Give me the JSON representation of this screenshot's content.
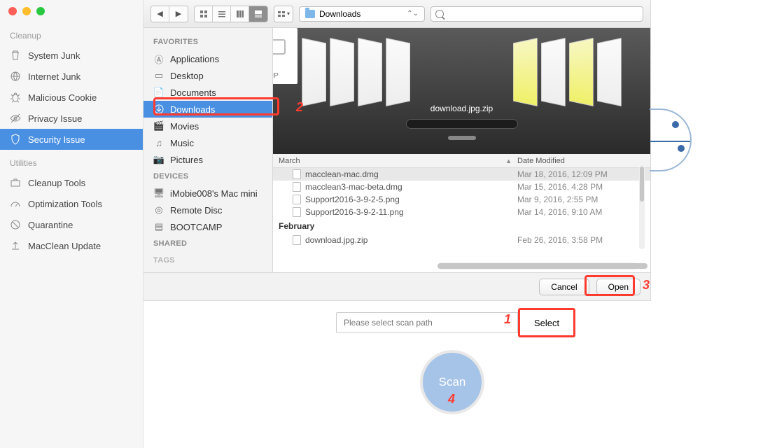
{
  "app": {
    "sections": {
      "cleanup": "Cleanup",
      "utilities": "Utilities"
    },
    "cleanup_items": [
      {
        "label": "System Junk",
        "icon": "trash"
      },
      {
        "label": "Internet Junk",
        "icon": "globe"
      },
      {
        "label": "Malicious Cookie",
        "icon": "bug"
      },
      {
        "label": "Privacy Issue",
        "icon": "eye"
      },
      {
        "label": "Security Issue",
        "icon": "shield",
        "active": true
      }
    ],
    "util_items": [
      {
        "label": "Cleanup Tools",
        "icon": "briefcase"
      },
      {
        "label": "Optimization Tools",
        "icon": "gauge"
      },
      {
        "label": "Quarantine",
        "icon": "block"
      },
      {
        "label": "MacClean Update",
        "icon": "upload"
      }
    ]
  },
  "finder": {
    "path_label": "Downloads",
    "search_placeholder": "",
    "sidebar": {
      "favorites": "FAVORITES",
      "devices": "DEVICES",
      "shared": "SHARED",
      "tags": "TAGS",
      "fav_items": [
        {
          "label": "Applications"
        },
        {
          "label": "Desktop"
        },
        {
          "label": "Documents"
        },
        {
          "label": "Downloads",
          "selected": true
        },
        {
          "label": "Movies"
        },
        {
          "label": "Music"
        },
        {
          "label": "Pictures"
        }
      ],
      "dev_items": [
        {
          "label": "iMobie008's Mac mini"
        },
        {
          "label": "Remote Disc"
        },
        {
          "label": "BOOTCAMP"
        }
      ]
    },
    "coverflow": {
      "center_label": "download.jpg.zip",
      "center_badge": "ZIP"
    },
    "columns": {
      "name": "March",
      "date": "Date Modified"
    },
    "groups": [
      {
        "name": "March",
        "rows": [
          {
            "name": "macclean-mac.dmg",
            "date": "Mar 18, 2016, 12:09 PM",
            "selected": true
          },
          {
            "name": "macclean3-mac-beta.dmg",
            "date": "Mar 15, 2016, 4:28 PM"
          },
          {
            "name": "Support2016-3-9-2-5.png",
            "date": "Mar 9, 2016, 2:55 PM"
          },
          {
            "name": "Support2016-3-9-2-11.png",
            "date": "Mar 14, 2016, 9:10 AM"
          }
        ]
      },
      {
        "name": "February",
        "rows": [
          {
            "name": "download.jpg.zip",
            "date": "Feb 26, 2016, 3:58 PM"
          }
        ]
      }
    ],
    "buttons": {
      "cancel": "Cancel",
      "open": "Open"
    }
  },
  "lower": {
    "scan_placeholder": "Please select scan path",
    "select_label": "Select",
    "scan_label": "Scan"
  },
  "annotations": {
    "n1": "1",
    "n2": "2",
    "n3": "3",
    "n4": "4"
  }
}
